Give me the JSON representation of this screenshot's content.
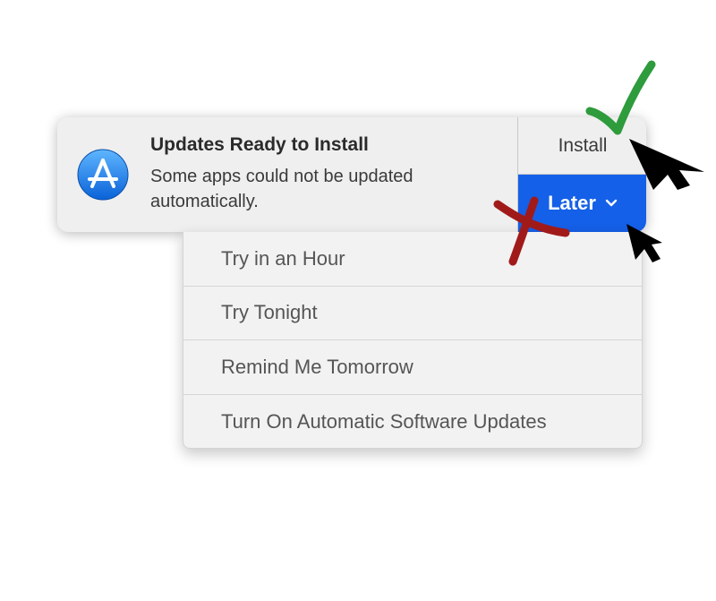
{
  "notification": {
    "title": "Updates Ready to Install",
    "body": "Some apps could not be updated automatically.",
    "icon": "app-store-icon",
    "install_label": "Install",
    "later_label": "Later"
  },
  "menu": {
    "items": [
      {
        "label": "Try in an Hour"
      },
      {
        "label": "Try Tonight"
      },
      {
        "label": "Remind Me Tomorrow"
      },
      {
        "label": "Turn On Automatic Software Updates"
      }
    ]
  },
  "colors": {
    "accent": "#1560e8",
    "banner_bg": "#efefef",
    "check_mark": "#2e9b3c",
    "x_mark": "#a11a1a",
    "cursor": "#000000"
  }
}
